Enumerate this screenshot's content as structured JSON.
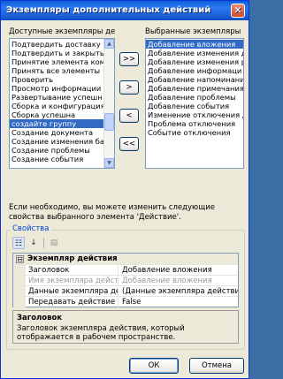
{
  "window": {
    "title": "Экземпляры дополнительных действий",
    "close_glyph": "✕"
  },
  "available": {
    "label": "Доступные экземпляры де",
    "items": [
      "Подтвердить доставку",
      "Подтвердить и закрыть",
      "Принятие элемента ком",
      "Принять все элементы ",
      "Проверить",
      "Просмотр информации р",
      "Развертывание успешн",
      "Сборка и конфигурация",
      "Сборка успешна",
      "создайте группу",
      "Создание документа",
      "Создание изменения ба",
      "Создание проблемы",
      "Создание события"
    ],
    "selected_index": 9
  },
  "selected": {
    "label": "Выбранные экземпляры",
    "items": [
      "Добавление вложения",
      "Добавление изменения д",
      "Добавление изменения р",
      "Добавление информаци",
      "Добавление напоминани",
      "Добавление примечания",
      "Добавление проблемы",
      "Добавление события",
      "Изменение отключения д",
      "Проблема отключения",
      "Событие отключения"
    ],
    "selected_index": 0
  },
  "move_buttons": {
    "add_all": ">>",
    "add": ">",
    "remove": "<",
    "remove_all": "<<"
  },
  "hint_text": "Если необходимо, вы можете изменить следующие свойства выбранного элемента 'Действие'.",
  "properties": {
    "group_title": "Свойства",
    "toolbar": {
      "categorized_icon": "categorized-icon",
      "alphabetical_icon": "alphabetical-icon",
      "property_pages_icon": "property-pages-icon"
    },
    "category": {
      "expander": "⊟",
      "title": "Экземпляр действия"
    },
    "rows": [
      {
        "name": "Заголовок",
        "value": "Добавление вложения",
        "disabled": false
      },
      {
        "name": "Имя экземпляра действия",
        "value": "Добавление вложения",
        "disabled": true
      },
      {
        "name": "Данные экземпляра действия",
        "value": "(Данные экземпляра действия)",
        "disabled": false
      },
      {
        "name": "Передавать действие дочерним",
        "value": "False",
        "disabled": false
      }
    ],
    "description": {
      "title": "Заголовок",
      "text": "Заголовок экземпляра действия, который отображается в рабочем пространстве."
    }
  },
  "footer": {
    "ok": "ОК",
    "cancel": "Отмена"
  },
  "colors": {
    "selection": "#316ac5",
    "titlebar": "#0a5fd8",
    "window_bg": "#ece9d8"
  }
}
